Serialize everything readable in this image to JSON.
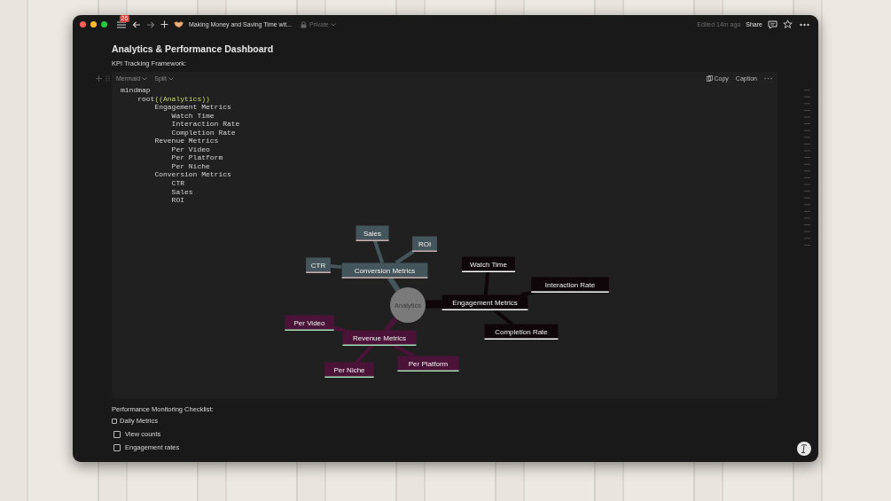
{
  "titlebar": {
    "notifications": "26",
    "page_title": "Making Money and Saving Time wit...",
    "privacy": "Private",
    "edited": "Edited 14m ago",
    "share": "Share"
  },
  "page": {
    "title": "Analytics & Performance Dashboard",
    "intro": "KPI Tracking Framework:"
  },
  "code_block": {
    "language": "Mermaid",
    "view": "Split",
    "copy": "Copy",
    "caption": "Caption",
    "lines": [
      [
        {
          "text": "mindmap",
          "kind": "plain"
        }
      ],
      [
        {
          "text": "    root",
          "kind": "plain"
        },
        {
          "text": "((Analytics))",
          "kind": "string"
        }
      ],
      [
        {
          "text": "        Engagement Metrics",
          "kind": "plain"
        }
      ],
      [
        {
          "text": "            Watch Time",
          "kind": "plain"
        }
      ],
      [
        {
          "text": "            Interaction Rate",
          "kind": "plain"
        }
      ],
      [
        {
          "text": "            Completion Rate",
          "kind": "plain"
        }
      ],
      [
        {
          "text": "        Revenue Metrics",
          "kind": "plain"
        }
      ],
      [
        {
          "text": "            Per Video",
          "kind": "plain"
        }
      ],
      [
        {
          "text": "            Per Platform",
          "kind": "plain"
        }
      ],
      [
        {
          "text": "            Per Niche",
          "kind": "plain"
        }
      ],
      [
        {
          "text": "        Conversion Metrics",
          "kind": "plain"
        }
      ],
      [
        {
          "text": "            CTR",
          "kind": "plain"
        }
      ],
      [
        {
          "text": "            Sales",
          "kind": "plain"
        }
      ],
      [
        {
          "text": "            ROI",
          "kind": "plain"
        }
      ]
    ]
  },
  "mindmap": {
    "root": "Analytics",
    "children": [
      {
        "label": "Conversion Metrics",
        "color": "#44565c",
        "children": [
          {
            "label": "CTR"
          },
          {
            "label": "Sales"
          },
          {
            "label": "ROI"
          }
        ]
      },
      {
        "label": "Engagement Metrics",
        "color": "#0e0608",
        "children": [
          {
            "label": "Watch Time"
          },
          {
            "label": "Interaction Rate"
          },
          {
            "label": "Completion Rate"
          }
        ]
      },
      {
        "label": "Revenue Metrics",
        "color": "#4b1338",
        "children": [
          {
            "label": "Per Video"
          },
          {
            "label": "Per Platform"
          },
          {
            "label": "Per Niche"
          }
        ]
      }
    ]
  },
  "checklist": {
    "heading": "Performance Monitoring Checklist:",
    "items": [
      {
        "label": "Daily Metrics",
        "checked": false,
        "kind": "compact"
      },
      {
        "label": "View counts",
        "checked": false,
        "kind": "indented"
      },
      {
        "label": "Engagement rates",
        "checked": false,
        "kind": "indented"
      }
    ]
  }
}
